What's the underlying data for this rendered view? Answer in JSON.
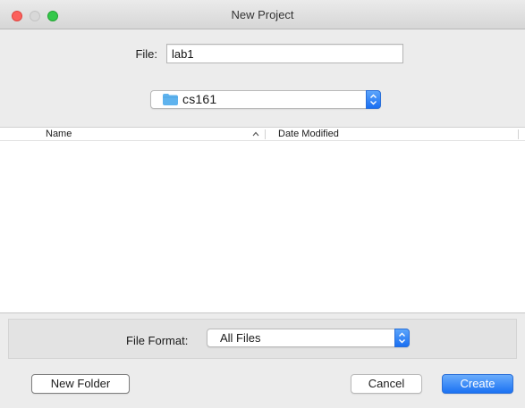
{
  "window": {
    "title": "New Project"
  },
  "file": {
    "label": "File:",
    "value": "lab1"
  },
  "location": {
    "folder": "cs161",
    "icon": "folder-icon"
  },
  "columns": {
    "name": "Name",
    "date_modified": "Date Modified",
    "sort_icon": "chevron-up-icon"
  },
  "file_format": {
    "label": "File Format:",
    "selected": "All Files"
  },
  "buttons": {
    "new_folder": "New Folder",
    "cancel": "Cancel",
    "create": "Create"
  },
  "colors": {
    "accent": "#1b72f3",
    "close": "#fc605c",
    "maximize": "#34c84a",
    "minimize_disabled": "#d8d8d8",
    "folder": "#5fb3ee"
  }
}
